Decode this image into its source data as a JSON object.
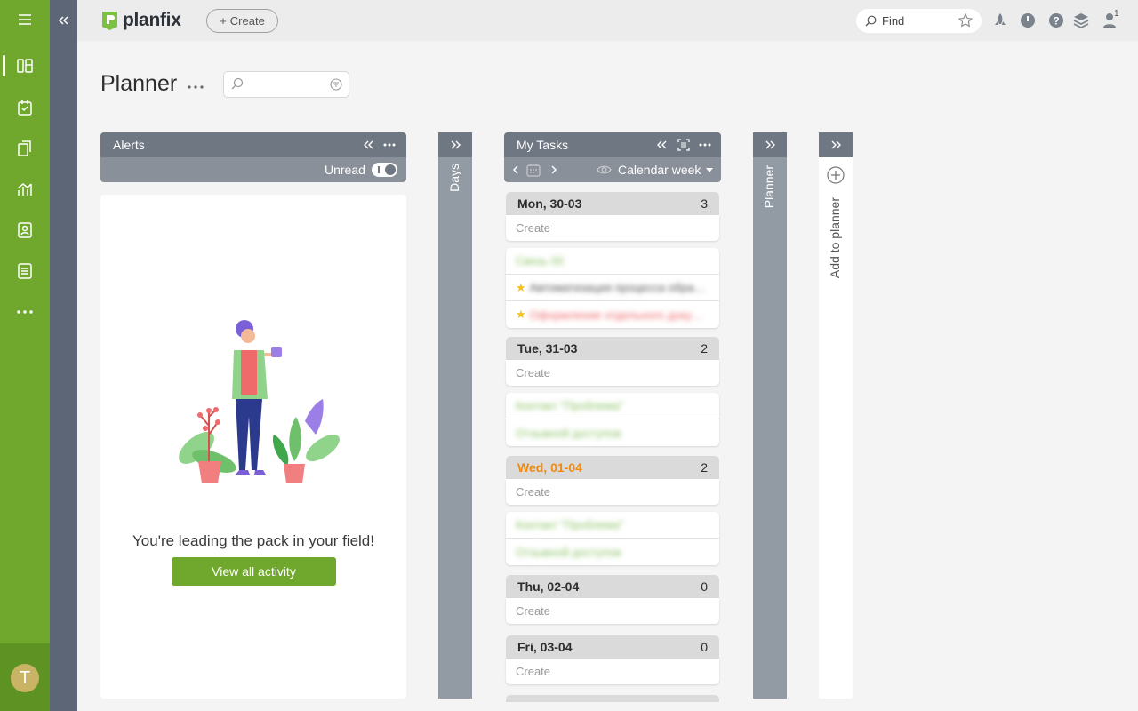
{
  "app": {
    "name": "planfix"
  },
  "header": {
    "create_label": "Create",
    "find_placeholder": "Find",
    "notification_count": "1"
  },
  "page": {
    "title": "Planner"
  },
  "alerts": {
    "title": "Alerts",
    "unread_label": "Unread",
    "empty_message": "You're leading the pack in your field!",
    "view_all_label": "View all activity"
  },
  "days_column": {
    "label": "Days"
  },
  "my_tasks": {
    "title": "My Tasks",
    "view_mode": "Calendar week",
    "days": [
      {
        "name": "Mon, 30-03",
        "count": "3",
        "create": "Create",
        "today": false,
        "tasks": [
          {
            "text": "Связь 00",
            "color": "green",
            "star": false
          },
          {
            "text": "Автоматизация процесса обработки",
            "color": "gray",
            "star": true
          },
          {
            "text": "Оформление отдельного документа",
            "color": "red",
            "star": true
          }
        ]
      },
      {
        "name": "Tue, 31-03",
        "count": "2",
        "create": "Create",
        "today": false,
        "tasks": [
          {
            "text": "Контакт \"Проблема\"",
            "color": "green",
            "star": false
          },
          {
            "text": "Отзывной доступов",
            "color": "green",
            "star": false
          }
        ]
      },
      {
        "name": "Wed, 01-04",
        "count": "2",
        "create": "Create",
        "today": true,
        "tasks": [
          {
            "text": "Контакт \"Проблема\"",
            "color": "green",
            "star": false
          },
          {
            "text": "Отзывной доступов",
            "color": "green",
            "star": false
          }
        ]
      },
      {
        "name": "Thu, 02-04",
        "count": "0",
        "create": "Create",
        "today": false,
        "tasks": []
      },
      {
        "name": "Fri, 03-04",
        "count": "0",
        "create": "Create",
        "today": false,
        "tasks": []
      }
    ]
  },
  "planner_column": {
    "label": "Planner"
  },
  "add_planner": {
    "label": "Add to planner"
  },
  "user": {
    "initial": "T"
  },
  "colors": {
    "rail": "#6fa82d",
    "strip": "#5c6677",
    "column_head": "#6e7782",
    "today": "#ef8a12"
  }
}
